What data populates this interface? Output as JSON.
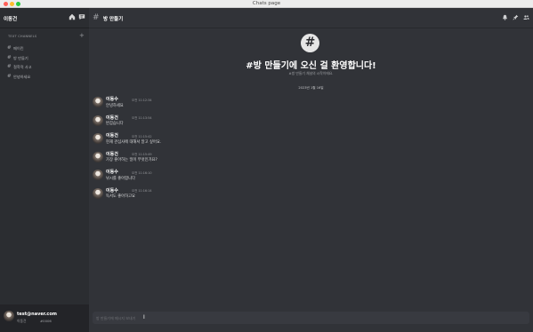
{
  "window": {
    "title": "Chats page",
    "controls": [
      {
        "name": "close",
        "color": "#ff5f57"
      },
      {
        "name": "minimize",
        "color": "#febc2e"
      },
      {
        "name": "zoom",
        "color": "#28c840"
      }
    ]
  },
  "sidebar": {
    "server_name": "이동건",
    "header_icons": [
      "home-icon",
      "message-icon"
    ],
    "channels_header": "TEXT CHANNELS",
    "add_icon": "plus-icon",
    "channels": [
      {
        "label": "메이킨"
      },
      {
        "label": "방 만들기"
      },
      {
        "label": "철학적 사고"
      },
      {
        "label": "안녕하세요"
      }
    ]
  },
  "user": {
    "email": "test@naver.com",
    "nickname": "이동건",
    "tag": "#0006"
  },
  "channel": {
    "name": "방 만들기",
    "header_icons": [
      "bell-icon",
      "pin-icon",
      "members-icon"
    ]
  },
  "welcome": {
    "badge": "#",
    "title": "#방 만들기에 오신 걸 환영합니다!",
    "subtitle": "#방 만들기 채널의 시작이에요."
  },
  "date_divider": "2023년 1월 16일",
  "messages": [
    {
      "author": "이동수",
      "time": "오전 11:12:34",
      "text": "안녕하세요"
    },
    {
      "author": "이동건",
      "time": "오전 11:13:54",
      "text": "반갑습니다"
    },
    {
      "author": "이동건",
      "time": "오전 11:15:42",
      "text": "현재 관심사에 대해서 알고 싶어요."
    },
    {
      "author": "이동건",
      "time": "오전 11:15:49",
      "text": "가장 좋아하는 일이 무엇인가요?"
    },
    {
      "author": "이동수",
      "time": "오전 11:16:10",
      "text": "낚시를 좋아합니다"
    },
    {
      "author": "이동수",
      "time": "오전 11:16:14",
      "text": "독서도 좋아하고요"
    }
  ],
  "composer": {
    "placeholder": "방 만들기에 메시지 보내기"
  }
}
